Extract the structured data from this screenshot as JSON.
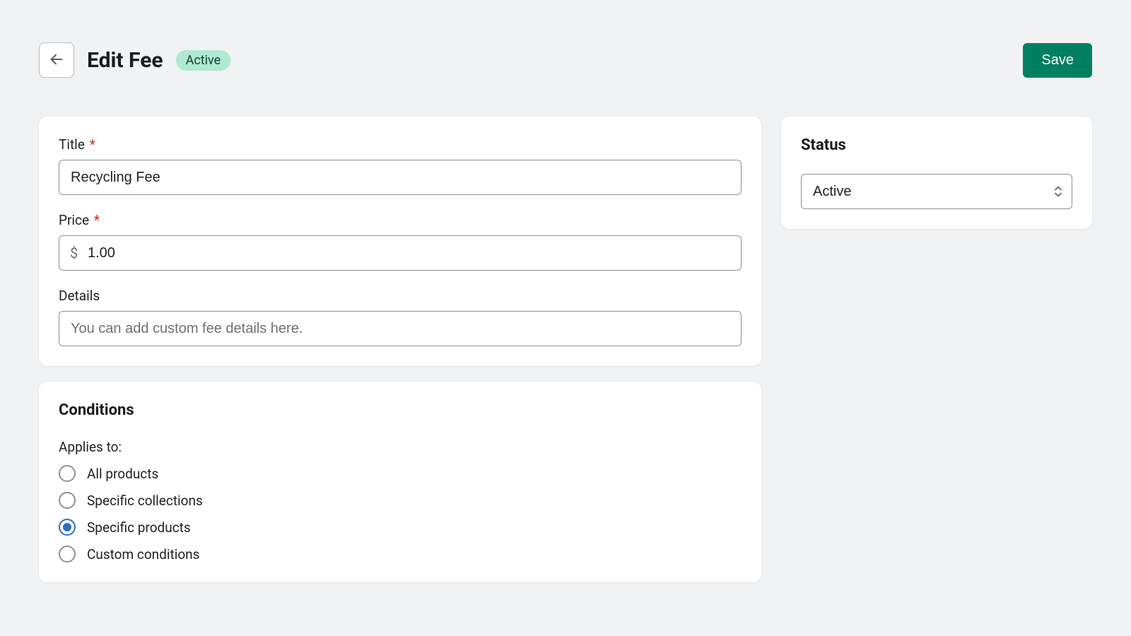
{
  "header": {
    "title": "Edit Fee",
    "badge": "Active",
    "save_label": "Save"
  },
  "form": {
    "title_label": "Title",
    "title_value": "Recycling Fee",
    "price_label": "Price",
    "price_currency": "$",
    "price_value": "1.00",
    "details_label": "Details",
    "details_placeholder": "You can add custom fee details here."
  },
  "conditions": {
    "section_title": "Conditions",
    "applies_label": "Applies to:",
    "selected_index": 2,
    "options": [
      "All products",
      "Specific collections",
      "Specific products",
      "Custom conditions"
    ]
  },
  "status": {
    "section_title": "Status",
    "selected": "Active"
  }
}
